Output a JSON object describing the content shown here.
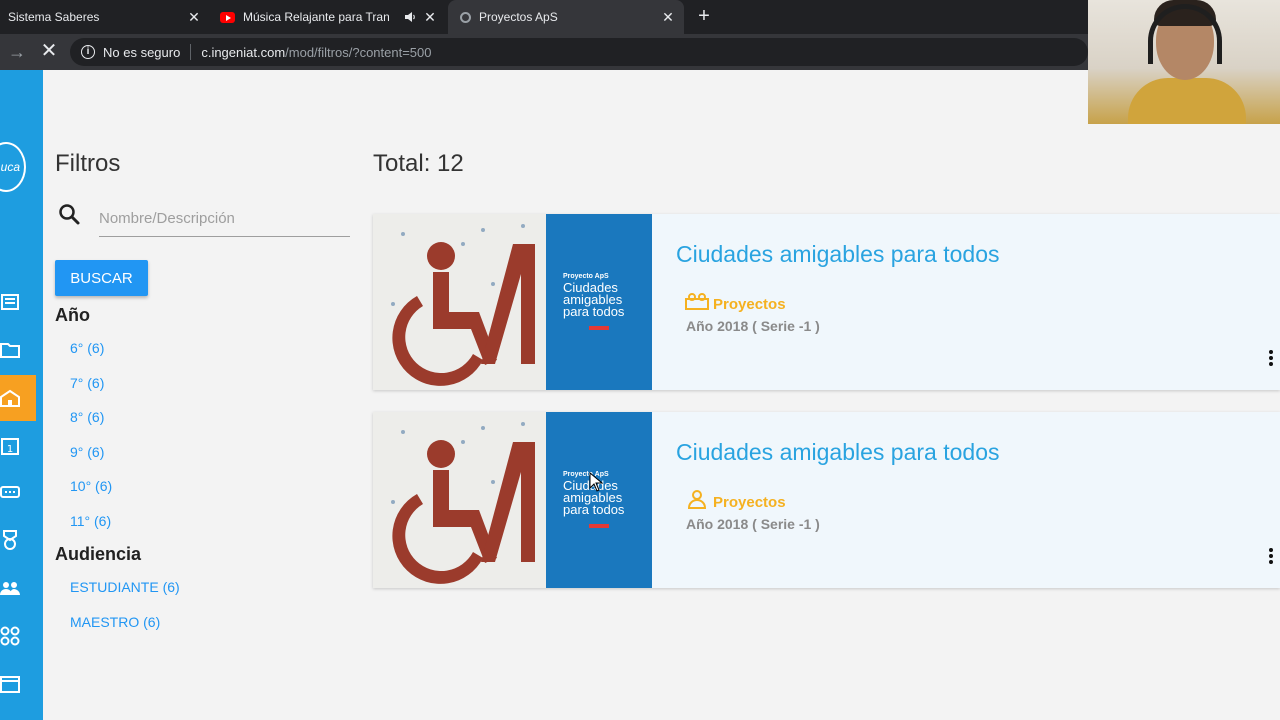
{
  "browser": {
    "tabs": [
      {
        "title": "Sistema Saberes",
        "icon": "page-icon"
      },
      {
        "title": "Música Relajante para Tranq",
        "icon": "youtube-icon"
      },
      {
        "title": "Proyectos ApS",
        "icon": "globe-icon",
        "active": true
      }
    ],
    "security_label": "No es seguro",
    "url_host": "c.ingeniat.com",
    "url_path": "/mod/filtros/?content=500"
  },
  "sidebar": {
    "logo_text": "uca",
    "icons": [
      "news-icon",
      "folder-icon",
      "school-icon",
      "calendar-icon",
      "ticket-icon",
      "medal-icon",
      "users-icon",
      "grid-icon",
      "window-icon"
    ]
  },
  "filters": {
    "heading": "Filtros",
    "search_placeholder": "Nombre/Descripción",
    "search_button": "BUSCAR",
    "year_title": "Año",
    "years": [
      "6° (6)",
      "7° (6)",
      "8° (6)",
      "9° (6)",
      "10° (6)",
      "11° (6)"
    ],
    "audience_title": "Audiencia",
    "audiences": [
      "ESTUDIANTE (6)",
      "MAESTRO (6)"
    ]
  },
  "results": {
    "total_label": "Total: 12",
    "items": [
      {
        "title": "Ciudades amigables para todos",
        "type": "Proyectos",
        "year": "Año 2018 ( Serie -1 )",
        "image_tag": "Proyecto ApS",
        "image_text": [
          "Ciudades",
          "amigables",
          "para todos"
        ]
      },
      {
        "title": "Ciudades amigables para todos",
        "type": "Proyectos",
        "year": "Año 2018 ( Serie -1 )",
        "image_tag": "Proyecto ApS",
        "image_text": [
          "Ciudades",
          "amigables",
          "para todos"
        ]
      }
    ]
  },
  "colors": {
    "sidebar": "#1e9de0",
    "accent_blue": "#2196f3",
    "title_blue": "#29a3e0",
    "orange": "#f5b120",
    "active_orange": "#f7a021",
    "card_bg": "#f0f7fc"
  }
}
